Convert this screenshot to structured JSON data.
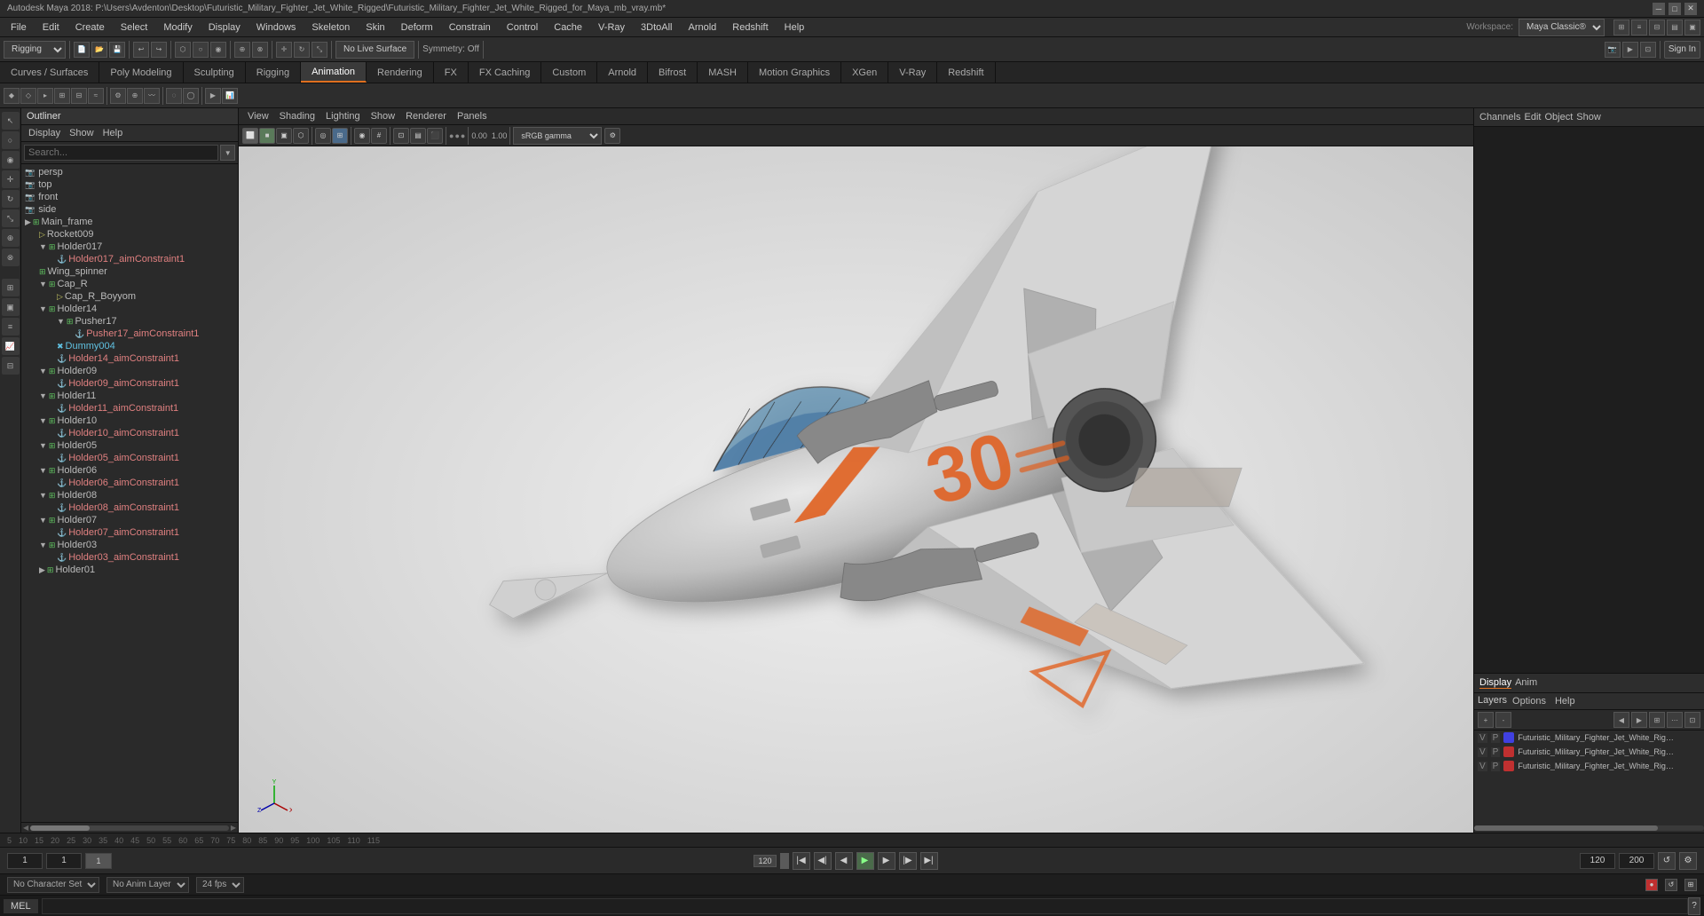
{
  "titlebar": {
    "title": "Autodesk Maya 2018: P:\\Users\\Avdenton\\Desktop\\Futuristic_Military_Fighter_Jet_White_Rigged\\Futuristic_Military_Fighter_Jet_White_Rigged_for_Maya_mb_vray.mb*",
    "controls": [
      "minimize",
      "maximize",
      "close"
    ]
  },
  "menu": {
    "items": [
      "File",
      "Edit",
      "Create",
      "Select",
      "Modify",
      "Display",
      "Windows",
      "Skeleton",
      "Skin",
      "Deform",
      "Constrain",
      "Control",
      "Cache",
      "V-Ray",
      "3DtoAll",
      "Arnold",
      "Redshift",
      "Help"
    ]
  },
  "toolbar1": {
    "rigging_label": "Rigging",
    "symmetry_label": "Symmetry: Off",
    "no_live_surface": "No Live Surface",
    "workspace_label": "Workspace:",
    "workspace_value": "Maya Classic",
    "sign_in": "Sign In"
  },
  "module_tabs": {
    "tabs": [
      {
        "label": "Curves / Surfaces",
        "active": false
      },
      {
        "label": "Poly Modeling",
        "active": false
      },
      {
        "label": "Sculpting",
        "active": false
      },
      {
        "label": "Rigging",
        "active": false
      },
      {
        "label": "Animation",
        "active": true
      },
      {
        "label": "Rendering",
        "active": false
      },
      {
        "label": "FX",
        "active": false
      },
      {
        "label": "FX Caching",
        "active": false
      },
      {
        "label": "Custom",
        "active": false
      },
      {
        "label": "Arnold",
        "active": false
      },
      {
        "label": "Bifrost",
        "active": false
      },
      {
        "label": "MASH",
        "active": false
      },
      {
        "label": "Motion Graphics",
        "active": false
      },
      {
        "label": "XGen",
        "active": false
      },
      {
        "label": "V-Ray",
        "active": false
      },
      {
        "label": "Redshift",
        "active": false
      }
    ]
  },
  "outliner": {
    "title": "Outliner",
    "menu": [
      "Display",
      "Show",
      "Help"
    ],
    "search_placeholder": "Search...",
    "tree_items": [
      {
        "label": "persp",
        "indent": 0,
        "type": "camera"
      },
      {
        "label": "top",
        "indent": 0,
        "type": "camera"
      },
      {
        "label": "front",
        "indent": 0,
        "type": "camera"
      },
      {
        "label": "side",
        "indent": 0,
        "type": "camera"
      },
      {
        "label": "Main_frame",
        "indent": 0,
        "type": "group"
      },
      {
        "label": "Rocket009",
        "indent": 1,
        "type": "mesh"
      },
      {
        "label": "Holder017",
        "indent": 1,
        "type": "group"
      },
      {
        "label": "Holder017_aimConstraint1",
        "indent": 2,
        "type": "constraint"
      },
      {
        "label": "Wing_spinner",
        "indent": 1,
        "type": "group"
      },
      {
        "label": "Cap_R",
        "indent": 1,
        "type": "group"
      },
      {
        "label": "Cap_R_Boyyom",
        "indent": 2,
        "type": "mesh"
      },
      {
        "label": "Holder14",
        "indent": 1,
        "type": "group"
      },
      {
        "label": "Pusher17",
        "indent": 2,
        "type": "group"
      },
      {
        "label": "Pusher17_aimConstraint1",
        "indent": 3,
        "type": "constraint"
      },
      {
        "label": "Dummy004",
        "indent": 2,
        "type": "dummy"
      },
      {
        "label": "Holder14_aimConstraint1",
        "indent": 2,
        "type": "constraint"
      },
      {
        "label": "Holder09",
        "indent": 1,
        "type": "group"
      },
      {
        "label": "Holder09_aimConstraint1",
        "indent": 2,
        "type": "constraint"
      },
      {
        "label": "Holder11",
        "indent": 1,
        "type": "group"
      },
      {
        "label": "Holder11_aimConstraint1",
        "indent": 2,
        "type": "constraint"
      },
      {
        "label": "Holder10",
        "indent": 1,
        "type": "group"
      },
      {
        "label": "Holder10_aimConstraint1",
        "indent": 2,
        "type": "constraint"
      },
      {
        "label": "Holder05",
        "indent": 1,
        "type": "group"
      },
      {
        "label": "Holder05_aimConstraint1",
        "indent": 2,
        "type": "constraint"
      },
      {
        "label": "Holder06",
        "indent": 1,
        "type": "group"
      },
      {
        "label": "Holder06_aimConstraint1",
        "indent": 2,
        "type": "constraint"
      },
      {
        "label": "Holder08",
        "indent": 1,
        "type": "group"
      },
      {
        "label": "Holder08_aimConstraint1",
        "indent": 2,
        "type": "constraint"
      },
      {
        "label": "Holder07",
        "indent": 1,
        "type": "group"
      },
      {
        "label": "Holder07_aimConstraint1",
        "indent": 2,
        "type": "constraint"
      },
      {
        "label": "Holder03",
        "indent": 1,
        "type": "group"
      },
      {
        "label": "Holder03_aimConstraint1",
        "indent": 2,
        "type": "constraint"
      },
      {
        "label": "Holder01",
        "indent": 1,
        "type": "group"
      }
    ]
  },
  "viewport": {
    "menu": [
      "View",
      "Shading",
      "Lighting",
      "Show",
      "Renderer",
      "Panels"
    ],
    "lighting_label": "Lighting",
    "gamma_label": "sRGB gamma",
    "camera_value": "0.00",
    "focal_value": "1.00"
  },
  "channels": {
    "header": [
      "Channels",
      "Edit",
      "Object",
      "Show"
    ]
  },
  "layers": {
    "header": [
      "Display",
      "Anim"
    ],
    "sub_header": [
      "Layers",
      "Options",
      "Help"
    ],
    "items": [
      {
        "v": "V",
        "p": "P",
        "color": "#4040e0",
        "name": "Futuristic_Military_Fighter_Jet_White_Rigged_Hel"
      },
      {
        "v": "V",
        "p": "P",
        "color": "#e04040",
        "name": "Futuristic_Military_Fighter_Jet_White_Rigged_Geom"
      },
      {
        "v": "V",
        "p": "P",
        "color": "#e04040",
        "name": "Futuristic_Military_Fighter_Jet_White_Rigged_Contr"
      }
    ]
  },
  "timeline": {
    "ticks": [
      "5",
      "10",
      "15",
      "20",
      "25",
      "30",
      "35",
      "40",
      "45",
      "50",
      "55",
      "60",
      "65",
      "70",
      "75",
      "80",
      "85",
      "90",
      "95",
      "100",
      "105",
      "110",
      "115"
    ],
    "start": "1",
    "current": "1",
    "end": "120",
    "range_end": "120",
    "max_end": "200",
    "fps": "24 fps"
  },
  "status_bar": {
    "no_character_set": "No Character Set",
    "no_anim_layer": "No Anim Layer",
    "fps": "24 fps"
  },
  "mel_bar": {
    "label": "MEL"
  }
}
